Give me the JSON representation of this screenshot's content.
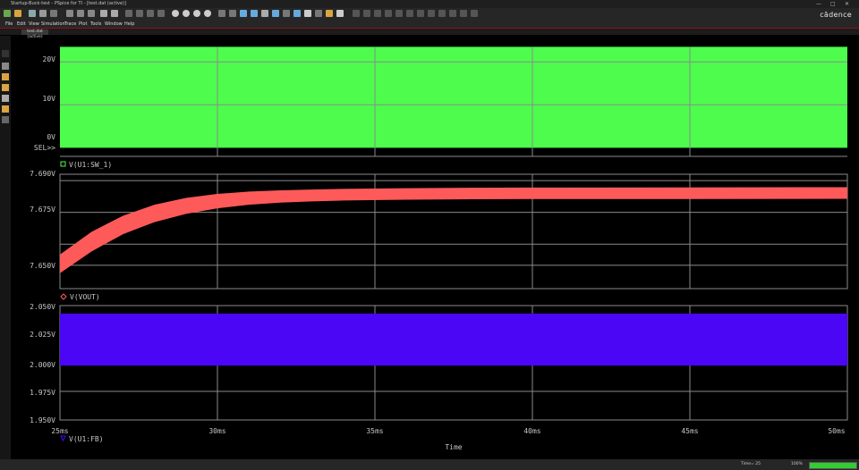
{
  "window": {
    "title": "Startup-Buck-test - PSpice for TI - [test.dat (active)]",
    "brand": "cādence"
  },
  "menu": [
    "File",
    "Edit",
    "View",
    "Simulation",
    "Trace",
    "Plot",
    "Tools",
    "Window",
    "Help"
  ],
  "tab_label": "test.dat (active)",
  "colors": {
    "green": "#4efc4e",
    "red": "#ff5a5a",
    "blue": "#4a06f5",
    "grid": "#8a8a8a"
  },
  "x_axis": {
    "ticks": [
      "25ms",
      "30ms",
      "35ms",
      "40ms",
      "45ms",
      "50ms"
    ],
    "label": "Time"
  },
  "plot1": {
    "ticks": [
      "20V",
      "10V",
      "0V"
    ],
    "sel": "SEL>>",
    "trace": "V(U1:SW_1)"
  },
  "plot2": {
    "ticks": [
      "7.690V",
      "7.675V",
      "7.650V"
    ],
    "trace": "V(VOUT)"
  },
  "plot3": {
    "ticks": [
      "2.050V",
      "2.025V",
      "2.000V",
      "1.975V",
      "1.950V"
    ],
    "trace": "V(U1:FB)"
  },
  "status": {
    "time": "Time= 25",
    "zoom": "100%",
    "progress": 1.0
  },
  "chart_data": [
    {
      "type": "line",
      "name": "V(U1:SW_1)",
      "x_unit": "ms",
      "y_unit": "V",
      "xlim": [
        25,
        50
      ],
      "ylim": [
        -2,
        24
      ],
      "band": {
        "min": 0,
        "max": 23.5
      }
    },
    {
      "type": "line",
      "name": "V(VOUT)",
      "x_unit": "ms",
      "y_unit": "V",
      "xlim": [
        25,
        50
      ],
      "ylim": [
        7.639,
        7.693
      ],
      "band_lower": {
        "x": [
          25,
          26,
          27,
          28,
          29,
          30,
          31,
          32,
          33,
          34,
          36,
          38,
          40,
          45,
          50
        ],
        "y": [
          7.6463,
          7.6565,
          7.6647,
          7.6704,
          7.6743,
          7.6769,
          7.6786,
          7.6796,
          7.6802,
          7.6806,
          7.681,
          7.6812,
          7.6813,
          7.6813,
          7.6814
        ]
      },
      "band_upper": {
        "x": [
          25,
          26,
          27,
          28,
          29,
          30,
          31,
          32,
          33,
          34,
          36,
          38,
          40,
          45,
          50
        ],
        "y": [
          7.6551,
          7.6658,
          7.6734,
          7.6786,
          7.6818,
          7.6837,
          7.6848,
          7.6854,
          7.6858,
          7.6861,
          7.6864,
          7.6866,
          7.6867,
          7.6868,
          7.6869
        ]
      }
    },
    {
      "type": "line",
      "name": "V(U1:FB)",
      "x_unit": "ms",
      "y_unit": "V",
      "xlim": [
        25,
        50
      ],
      "ylim": [
        1.95,
        2.05
      ],
      "band": {
        "min": 1.9975,
        "max": 2.043
      }
    }
  ]
}
